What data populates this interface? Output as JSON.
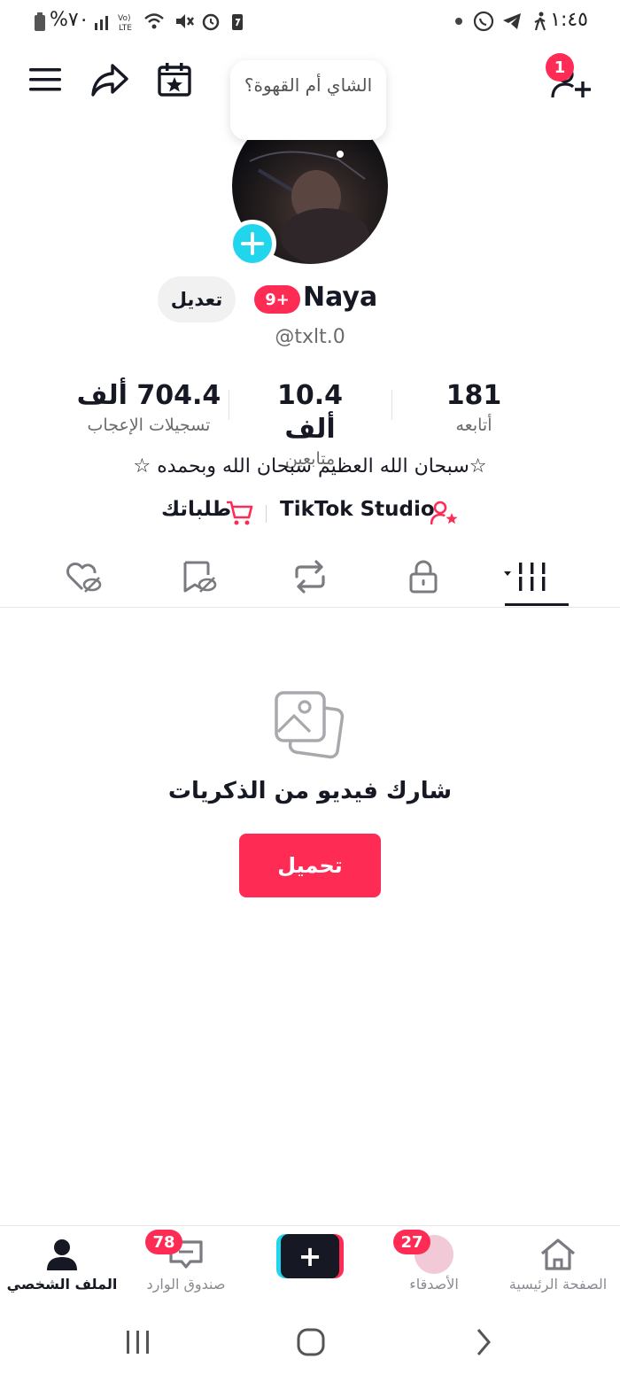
{
  "status_bar": {
    "time": "١:٤٥",
    "battery": "%٧٠"
  },
  "header": {
    "friend_requests_count": "1"
  },
  "note_bubble": "الشاي أم القهوة؟",
  "profile": {
    "name": "Naya",
    "badge": "9+",
    "handle": "@txlt.0",
    "edit_label": "تعديل",
    "bio": "☆سبحان الله العظيم سبحان الله وبحمده ☆"
  },
  "stats": [
    {
      "value": "181",
      "label": "أتابعه"
    },
    {
      "value": "10.4 ألف",
      "label": "متابعين"
    },
    {
      "value": "704.4 ألف",
      "label": "تسجيلات الإعجاب"
    }
  ],
  "links": {
    "studio": "TikTok Studio",
    "orders": "طلباتك"
  },
  "tabs": [
    "videos",
    "private",
    "reposts",
    "favorites",
    "liked"
  ],
  "empty_state": {
    "message": "شارك فيديو من الذكريات",
    "button": "تحميل"
  },
  "bottom_nav": {
    "home": "الصفحة الرئيسية",
    "friends": "الأصدقاء",
    "friends_badge": "27",
    "inbox": "صندوق الوارد",
    "inbox_badge": "78",
    "profile": "الملف الشخصي"
  },
  "colors": {
    "accent": "#fe2c55",
    "cyan": "#20d5ec",
    "text": "#161823"
  }
}
